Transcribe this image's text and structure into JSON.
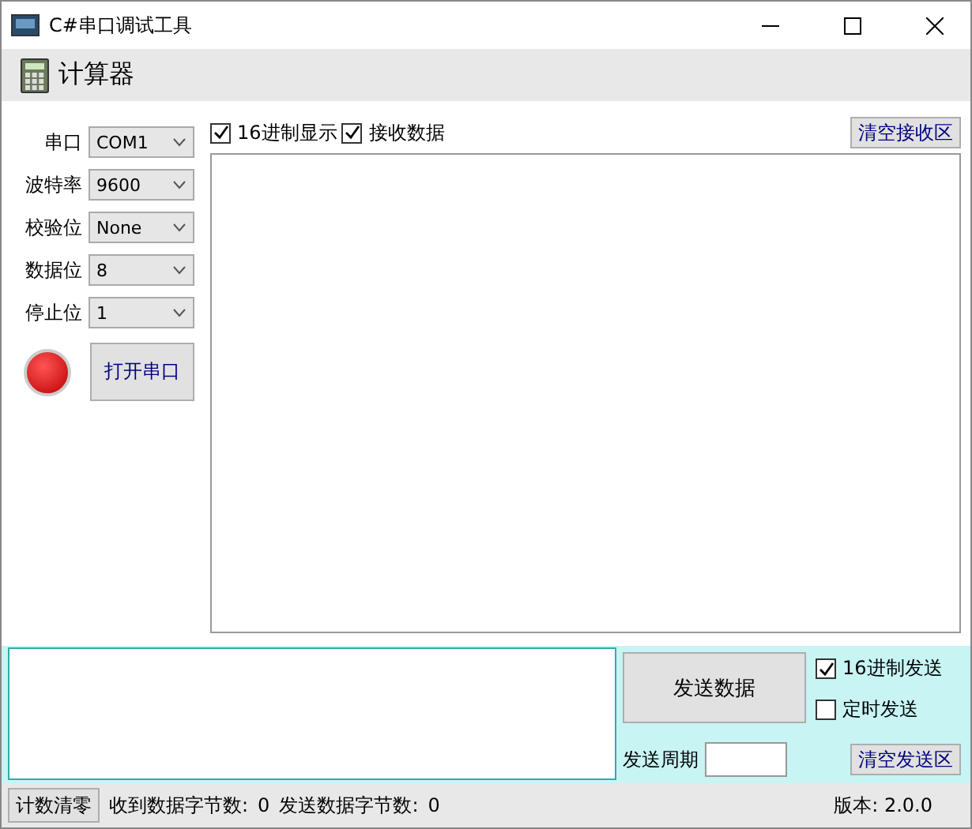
{
  "window": {
    "title": "C#串口调试工具"
  },
  "menu": {
    "label": "计算器"
  },
  "settings": [
    {
      "label": "串口",
      "value": "COM1"
    },
    {
      "label": "波特率",
      "value": "9600"
    },
    {
      "label": "校验位",
      "value": "None"
    },
    {
      "label": "数据位",
      "value": "8"
    },
    {
      "label": "停止位",
      "value": "1"
    }
  ],
  "port": {
    "on": false,
    "button": "打开串口"
  },
  "receive": {
    "options": [
      {
        "label": "16进制显示",
        "checked": true
      },
      {
        "label": "接收数据",
        "checked": true
      }
    ],
    "clear_button": "清空接收区"
  },
  "send": {
    "button": "发送数据",
    "options": [
      {
        "label": "16进制发送",
        "checked": true
      },
      {
        "label": "定时发送",
        "checked": false
      }
    ],
    "period_label": "发送周期",
    "clear_button": "清空发送区"
  },
  "status_bar": {
    "reset_button": "计数清零",
    "received_label": "收到数据字节数:",
    "received": "0",
    "sent_label": "发送数据字节数:",
    "sent": "0",
    "version": "版本: 2.0.0"
  }
}
